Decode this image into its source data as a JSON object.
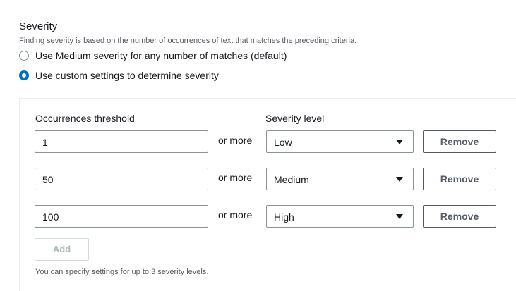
{
  "severity": {
    "title": "Severity",
    "description": "Finding severity is based on the number of occurrences of text that matches the preceding criteria.",
    "options": [
      {
        "label": "Use Medium severity for any number of matches (default)",
        "checked": false
      },
      {
        "label": "Use custom settings to determine severity",
        "checked": true
      }
    ]
  },
  "table": {
    "threshold_header": "Occurrences threshold",
    "level_header": "Severity level",
    "or_more": "or more",
    "remove_label": "Remove",
    "rows": [
      {
        "threshold": "1",
        "level": "Low"
      },
      {
        "threshold": "50",
        "level": "Medium"
      },
      {
        "threshold": "100",
        "level": "High"
      }
    ]
  },
  "add_label": "Add",
  "note": "You can specify settings for up to 3 severity levels.",
  "colors": {
    "accent": "#0073bb",
    "text": "#16191f",
    "muted": "#545b64"
  }
}
